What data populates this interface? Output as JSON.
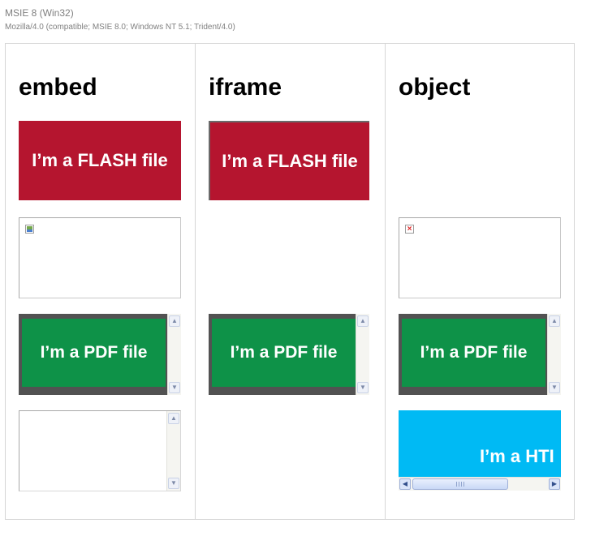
{
  "header": {
    "browser": "MSIE 8 (Win32)",
    "user_agent": "Mozilla/4.0 (compatible; MSIE 8.0; Windows NT 5.1; Trident/4.0)"
  },
  "columns": {
    "embed": {
      "heading": "embed"
    },
    "iframe": {
      "heading": "iframe"
    },
    "object": {
      "heading": "object"
    }
  },
  "content": {
    "flash_text": "I’m a FLASH file",
    "pdf_text": "I’m a PDF file",
    "html_text": "I’m a HTI"
  },
  "icons": {
    "broken_image": "broken-image-icon",
    "missing_plugin": "red-x-icon",
    "scroll_up": "▲",
    "scroll_down": "▼",
    "scroll_left": "◀",
    "scroll_right": "▶"
  },
  "colors": {
    "flash": "#b5152f",
    "pdf": "#0e9248",
    "html": "#00baf4",
    "pdf_viewer": "#525252"
  }
}
